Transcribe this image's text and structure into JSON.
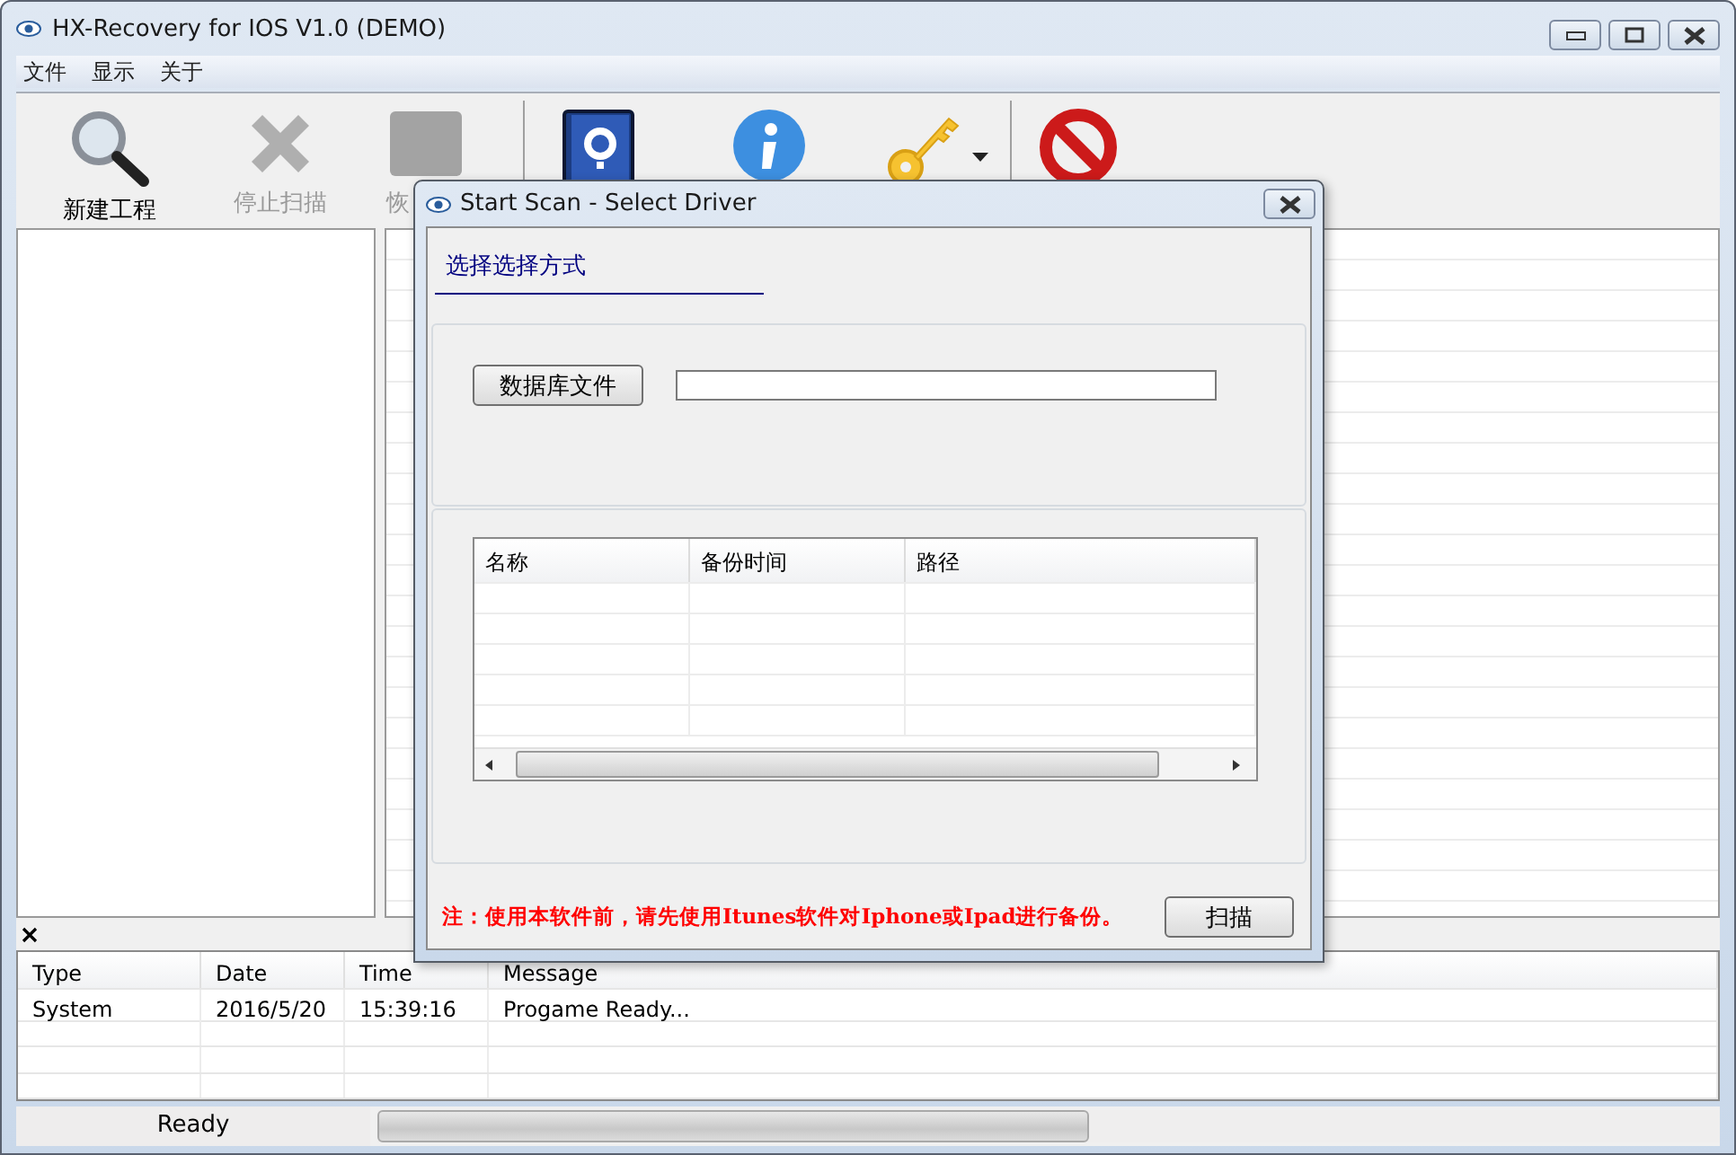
{
  "window": {
    "title": "HX-Recovery for IOS V1.0 (DEMO)"
  },
  "menu": [
    "文件",
    "显示",
    "关于"
  ],
  "toolbar": [
    {
      "label": "新建工程",
      "disabled": false,
      "dropdown": false
    },
    {
      "label": "停止扫描",
      "disabled": true,
      "dropdown": false
    },
    {
      "label": "恢",
      "disabled": true,
      "dropdown": false
    },
    {
      "disabled": false,
      "dropdown": false
    },
    {
      "disabled": false,
      "dropdown": false
    },
    {
      "disabled": false,
      "dropdown": true
    },
    {
      "disabled": false,
      "dropdown": false
    }
  ],
  "log": {
    "columns": [
      "Type",
      "Date",
      "Time",
      "Message"
    ],
    "rows": [
      [
        "System",
        "2016/5/20",
        "15:39:16",
        "Progame Ready..."
      ]
    ]
  },
  "status_bar": {
    "text": "Ready",
    "progress": {
      "level": 0.53
    }
  },
  "dialog": {
    "title": "Start Scan - Select Driver",
    "heading": "选择选择方式",
    "source_button": "数据库文件",
    "table": {
      "columns": [
        "名称",
        "备份时间",
        "路径"
      ]
    },
    "note": "注：使用本软件前，请先使用Itunes软件对Iphone或Ipad进行备份。",
    "scan_button": "扫描"
  }
}
